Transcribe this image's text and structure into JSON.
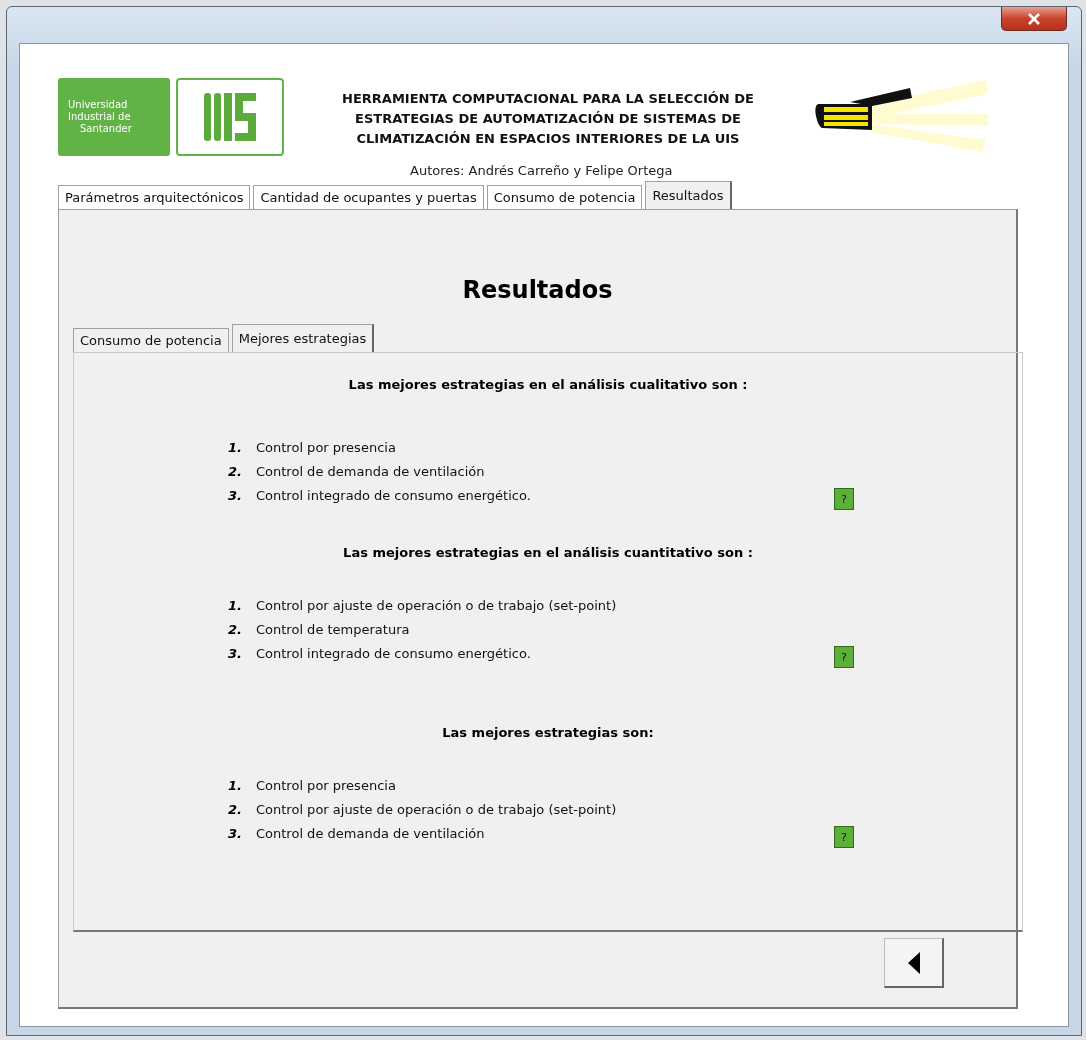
{
  "header": {
    "logo_text": [
      "Universidad",
      "Industrial de",
      "Santander"
    ],
    "title_lines": [
      "HERRAMIENTA COMPUTACIONAL PARA LA SELECCIÓN DE",
      "ESTRATEGIAS DE AUTOMATIZACIÓN DE SISTEMAS DE",
      "CLIMATIZACIÓN EN ESPACIOS INTERIORES DE LA UIS"
    ],
    "authors": "Autores: Andrés Carreño y Felipe Ortega"
  },
  "tabs": [
    {
      "label": "Parámetros arquitectónicos",
      "selected": false
    },
    {
      "label": "Cantidad de ocupantes y puertas",
      "selected": false
    },
    {
      "label": "Consumo de potencia",
      "selected": false
    },
    {
      "label": "Resultados",
      "selected": true
    }
  ],
  "page_title": "Resultados",
  "subtabs": [
    {
      "label": "Consumo de potencia",
      "selected": false
    },
    {
      "label": "Mejores estrategias",
      "selected": true
    }
  ],
  "sections": [
    {
      "heading": "Las mejores estrategias en el análisis cualitativo son :",
      "help": "?",
      "items": [
        {
          "number": "1.",
          "text": "Control por presencia"
        },
        {
          "number": "2.",
          "text": "Control de demanda de ventilación"
        },
        {
          "number": "3.",
          "text": "Control integrado de consumo energético."
        }
      ]
    },
    {
      "heading": "Las mejores estrategias en el análisis cuantitativo son :",
      "help": "?",
      "items": [
        {
          "number": "1.",
          "text": "Control por ajuste de operación o de trabajo (set-point)"
        },
        {
          "number": "2.",
          "text": "Control de temperatura"
        },
        {
          "number": "3.",
          "text": "Control integrado de consumo energético."
        }
      ]
    },
    {
      "heading": "Las mejores estrategias son:",
      "help": "?",
      "items": [
        {
          "number": "1.",
          "text": "Control por presencia"
        },
        {
          "number": "2.",
          "text": "Control por ajuste de operación o de trabajo (set-point)"
        },
        {
          "number": "3.",
          "text": "Control de demanda de ventilación"
        }
      ]
    }
  ]
}
